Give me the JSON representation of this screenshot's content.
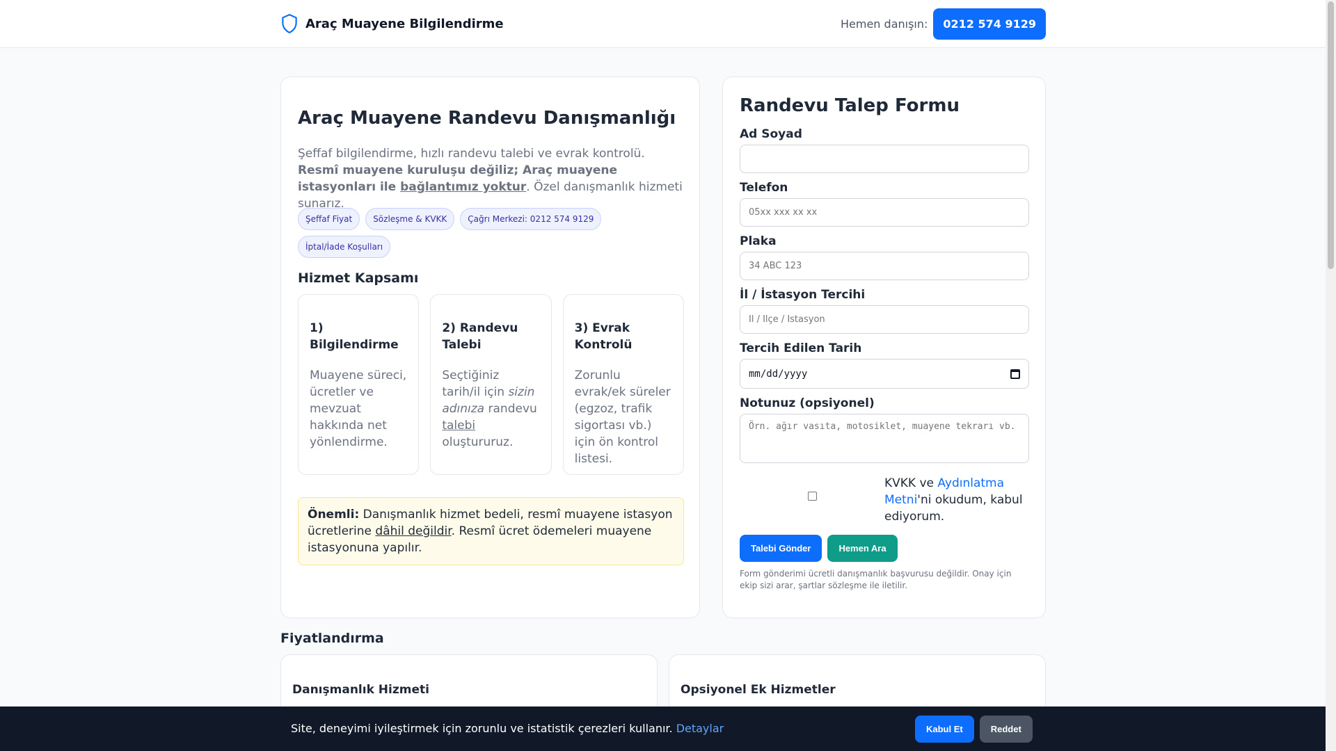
{
  "header": {
    "brand_title": "Araç Muayene Bilgilendirme",
    "consult_label": "Hemen danışın:",
    "phone": "0212 574 9129"
  },
  "intro": {
    "title": "Araç Muayene Randevu Danışmanlığı",
    "text_plain": "Şeffaf bilgilendirme, hızlı randevu talebi ve evrak kontrolü. ",
    "text_bold": "Resmî muayene kuruluşu değiliz; Araç muayene istasyonları ile ",
    "text_bold_underline": "bağlantımız yoktur",
    "text_end": ". Özel danışmanlık hizmeti sunarız.",
    "pills": [
      "Şeffaf Fiyat",
      "Sözleşme & KVKK",
      "Çağrı Merkezi: 0212 574 9129",
      "İptal/İade Koşulları"
    ]
  },
  "scope": {
    "title": "Hizmet Kapsamı",
    "steps": [
      {
        "title": "1) Bilgilendirme",
        "text": "Muayene süreci, ücretler ve mevzuat hakkında net yönlendirme."
      },
      {
        "title": "2) Randevu Talebi",
        "text_a": "Seçtiğiniz tarih/il için ",
        "text_italic": "sizin adınıza",
        "text_b": " randevu ",
        "text_underline": "talebi",
        "text_c": " oluştururuz."
      },
      {
        "title": "3) Evrak Kontrolü",
        "text": "Zorunlu evrak/ek süreler (egzoz, trafik sigortası vb.) için ön kontrol listesi."
      }
    ]
  },
  "notice": {
    "label": "Önemli:",
    "text_a": " Danışmanlık hizmet bedeli, resmî muayene istasyon ücretlerine ",
    "text_underline": "dâhil değildir",
    "text_b": ". Resmî ücret ödemeleri muayene istasyonuna yapılır."
  },
  "form": {
    "title": "Randevu Talep Formu",
    "name_label": "Ad Soyad",
    "name_value": "",
    "phone_label": "Telefon",
    "phone_placeholder": "05xx xxx xx xx",
    "plate_label": "Plaka",
    "plate_placeholder": "34 ABC 123",
    "station_label": "İl / İstasyon Tercihi",
    "station_placeholder": "İl / İlçe / İstasyon",
    "date_label": "Tercih Edilen Tarih",
    "date_value": "mm/dd/yyyy",
    "note_label": "Notunuz (opsiyonel)",
    "note_placeholder": "Örn. ağır vasıta, motosiklet, muayene tekrarı vb.",
    "kvkk_prefix": "KVKK ve ",
    "kvkk_link": "Aydınlatma Metni",
    "kvkk_suffix": "'ni okudum, kabul ediyorum.",
    "kvkk_checked": false,
    "submit_label": "Talebi Gönder",
    "call_label": "Hemen Ara",
    "footnote": "Form gönderimi ücretli danışmanlık başvurusu değildir. Onay için ekip sizi arar, şartlar sözleşme ile iletilir."
  },
  "pricing": {
    "title": "Fiyatlandırma",
    "cards": [
      "Danışmanlık Hizmeti",
      "Opsiyonel Ek Hizmetler"
    ]
  },
  "cookie": {
    "text": "Site, deneyimi iyileştirmek için zorunlu ve istatistik çerezleri kullanır. ",
    "link": "Detaylar",
    "accept_label": "Kabul Et",
    "reject_label": "Reddet"
  },
  "colors": {
    "primary": "#0d6efd",
    "teal": "#0f9d8a",
    "cookie_bg": "#111827"
  }
}
